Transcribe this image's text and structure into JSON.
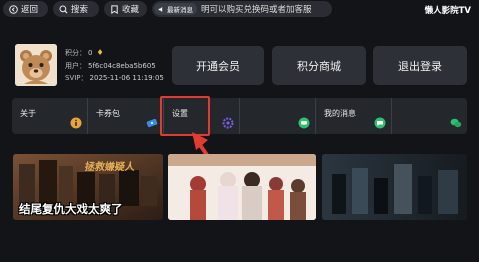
{
  "topbar": {
    "back_label": "返回",
    "search_label": "搜索",
    "favorite_label": "收藏",
    "notice_tag": "最新消息",
    "notice_text": "明可以购买兑换码或者加客服",
    "app_name": "懒人影院TV"
  },
  "user": {
    "points_label": "积分：",
    "points_value": "0",
    "user_label": "用户：",
    "user_id": "5f6c04c8eba5b605",
    "svip_label": "SVIP：",
    "svip_expire": "2025-11-06 11:19:05"
  },
  "actions": {
    "vip_label": "开通会员",
    "mall_label": "积分商城",
    "logout_label": "退出登录"
  },
  "menu": {
    "about_label": "关于",
    "card_label": "卡券包",
    "settings_label": "设置",
    "messages_label": "我的消息"
  },
  "posters": {
    "first_title": "拯救嫌疑人",
    "first_caption": "结尾复仇大戏太爽了"
  },
  "colors": {
    "background": "#121418",
    "highlight": "#e23b30",
    "icon_green": "#2fbf71",
    "icon_yellow": "#e8a33a",
    "icon_purple": "#7a5cf0",
    "gem": "#e6b94b"
  }
}
